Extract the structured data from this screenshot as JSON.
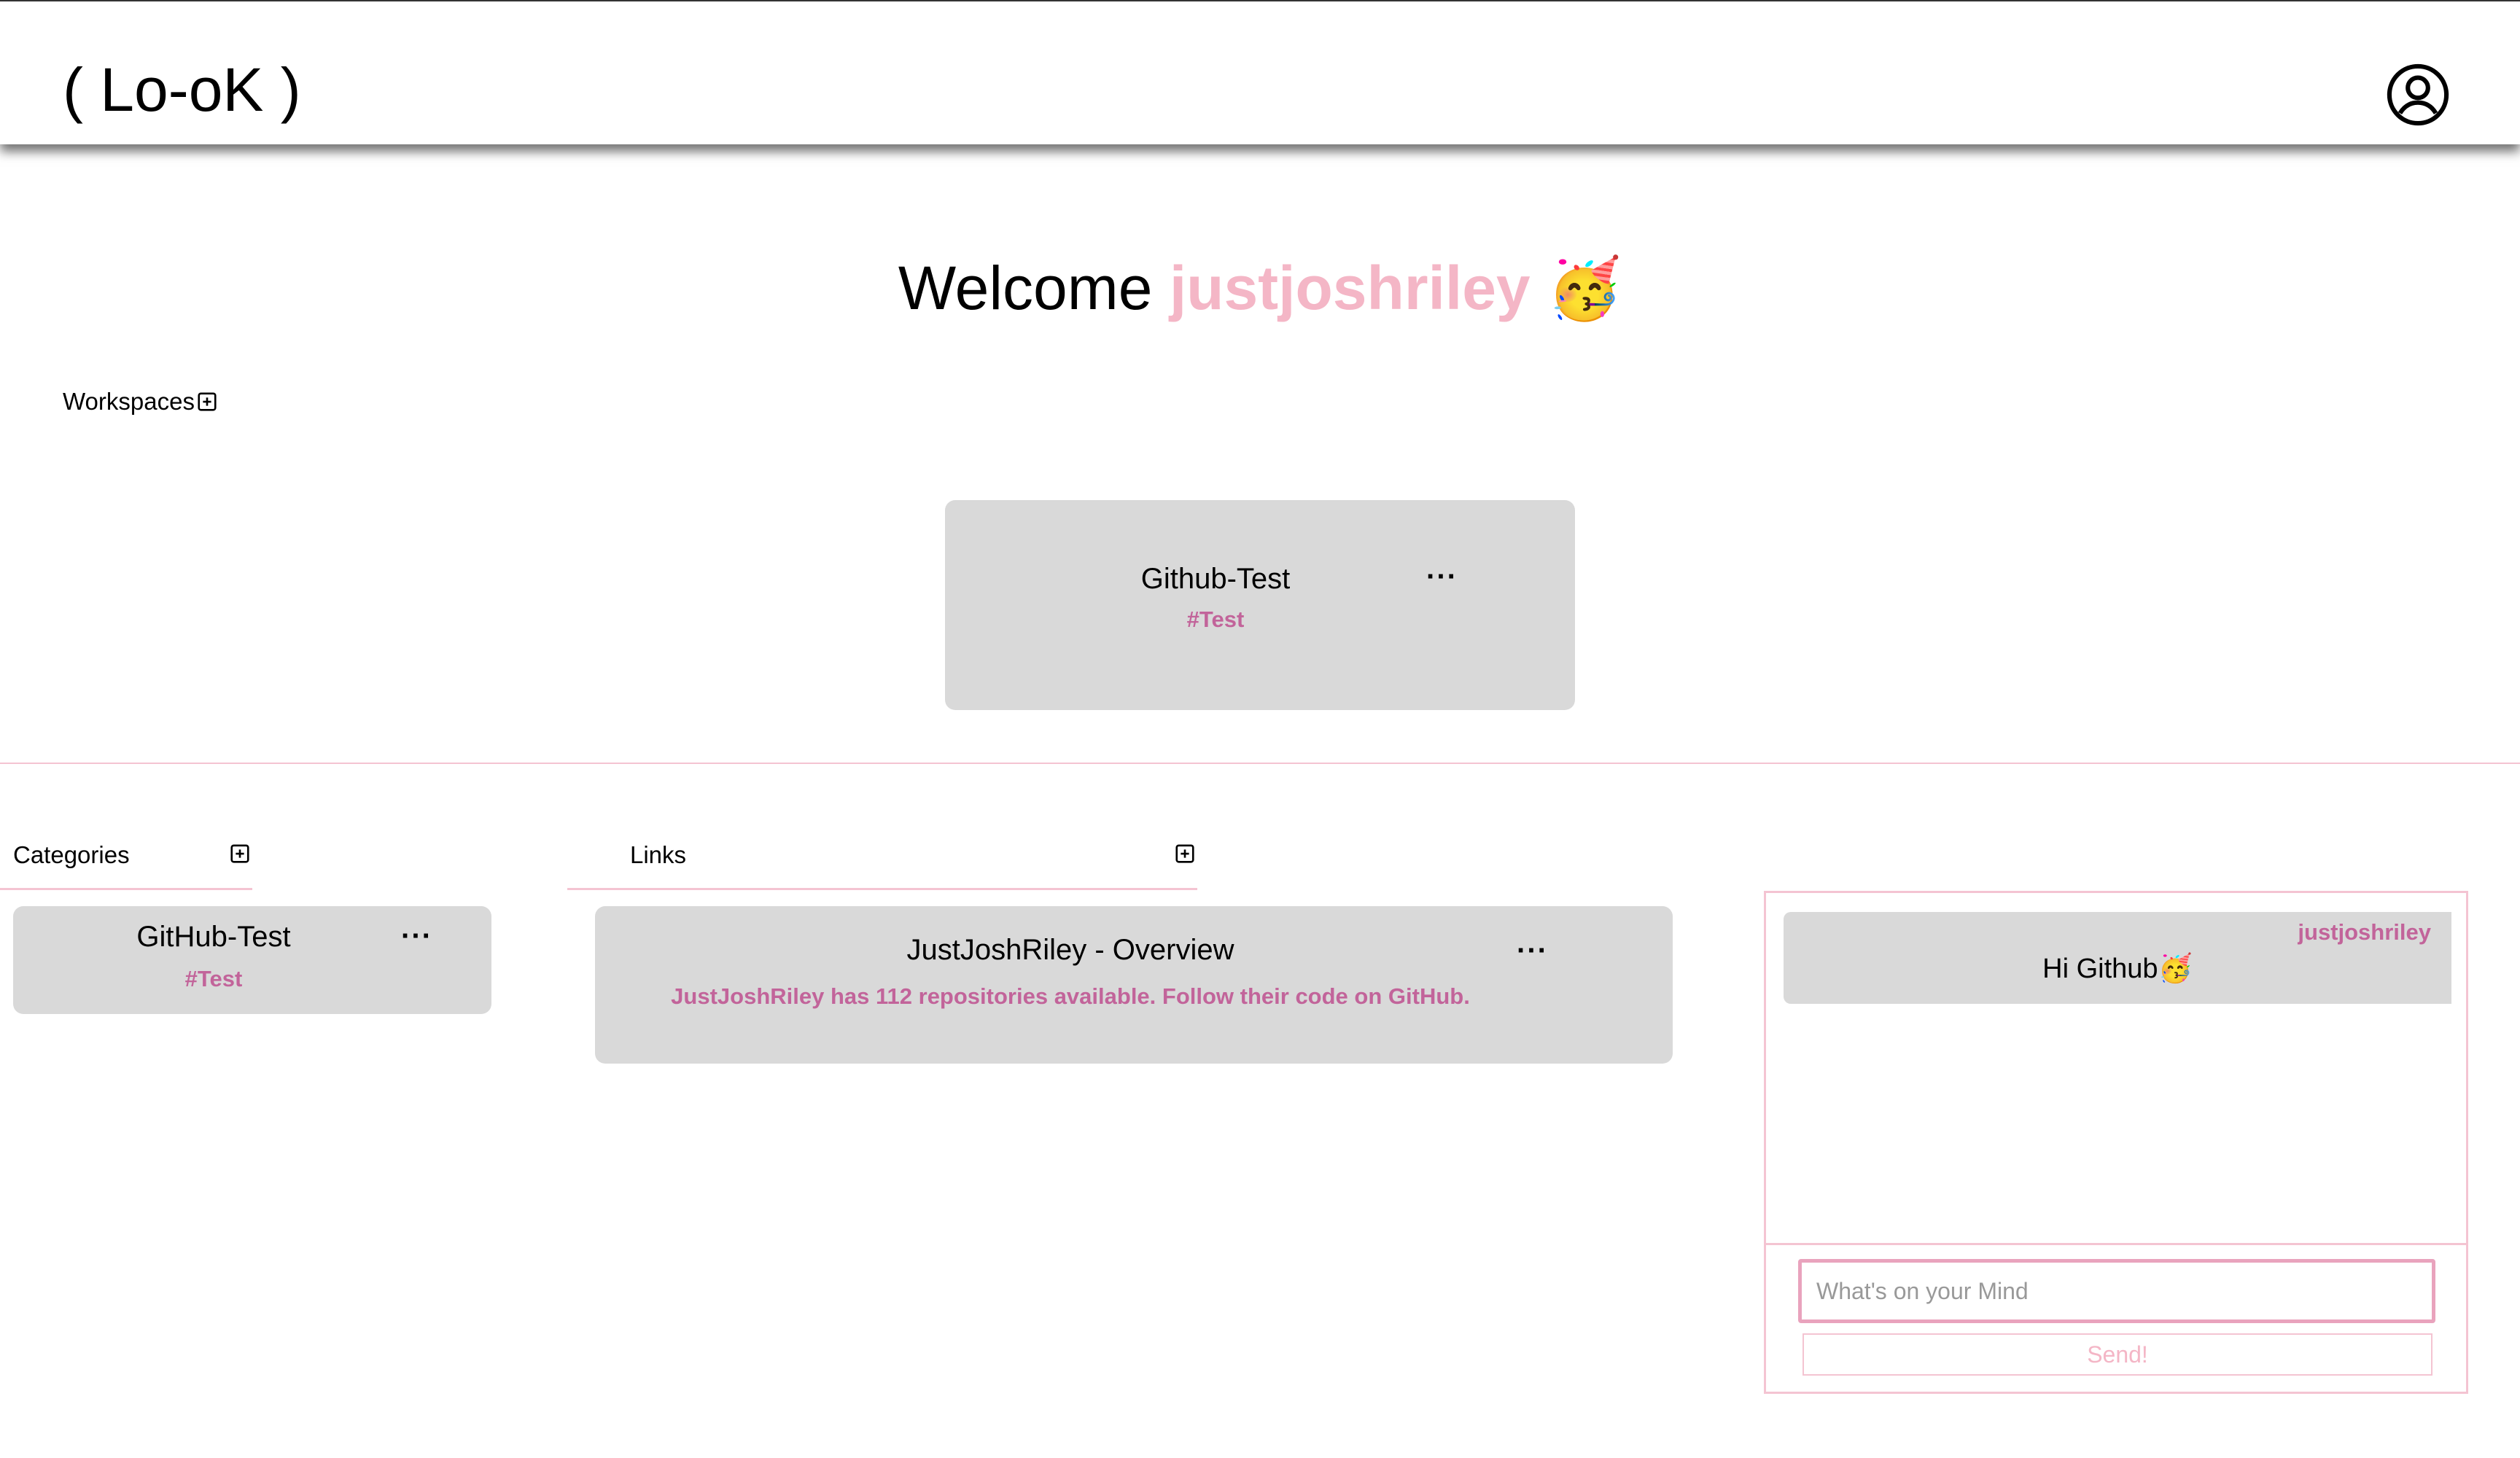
{
  "header": {
    "logo": "( Lo-oK )"
  },
  "welcome": {
    "prefix": "Welcome",
    "username": "justjoshriley",
    "emoji": "🥳"
  },
  "workspaces": {
    "label": "Workspaces",
    "items": [
      {
        "name": "Github-Test",
        "tag": "#Test",
        "menu": "···"
      }
    ]
  },
  "categories": {
    "label": "Categories",
    "items": [
      {
        "name": "GitHub-Test",
        "tag": "#Test",
        "menu": "···"
      }
    ]
  },
  "links": {
    "label": "Links",
    "items": [
      {
        "title": "JustJoshRiley - Overview",
        "description": "JustJoshRiley has 112 repositories available. Follow their code on GitHub.",
        "menu": "···"
      }
    ]
  },
  "chat": {
    "messages": [
      {
        "user": "justjoshriley",
        "text": "Hi Github🥳"
      }
    ],
    "input_placeholder": "What's on your Mind",
    "send_label": "Send!"
  },
  "colors": {
    "accent_pink": "#f4b6c6",
    "tag_pink": "#c2649a",
    "card_gray": "#d9d9d9"
  }
}
